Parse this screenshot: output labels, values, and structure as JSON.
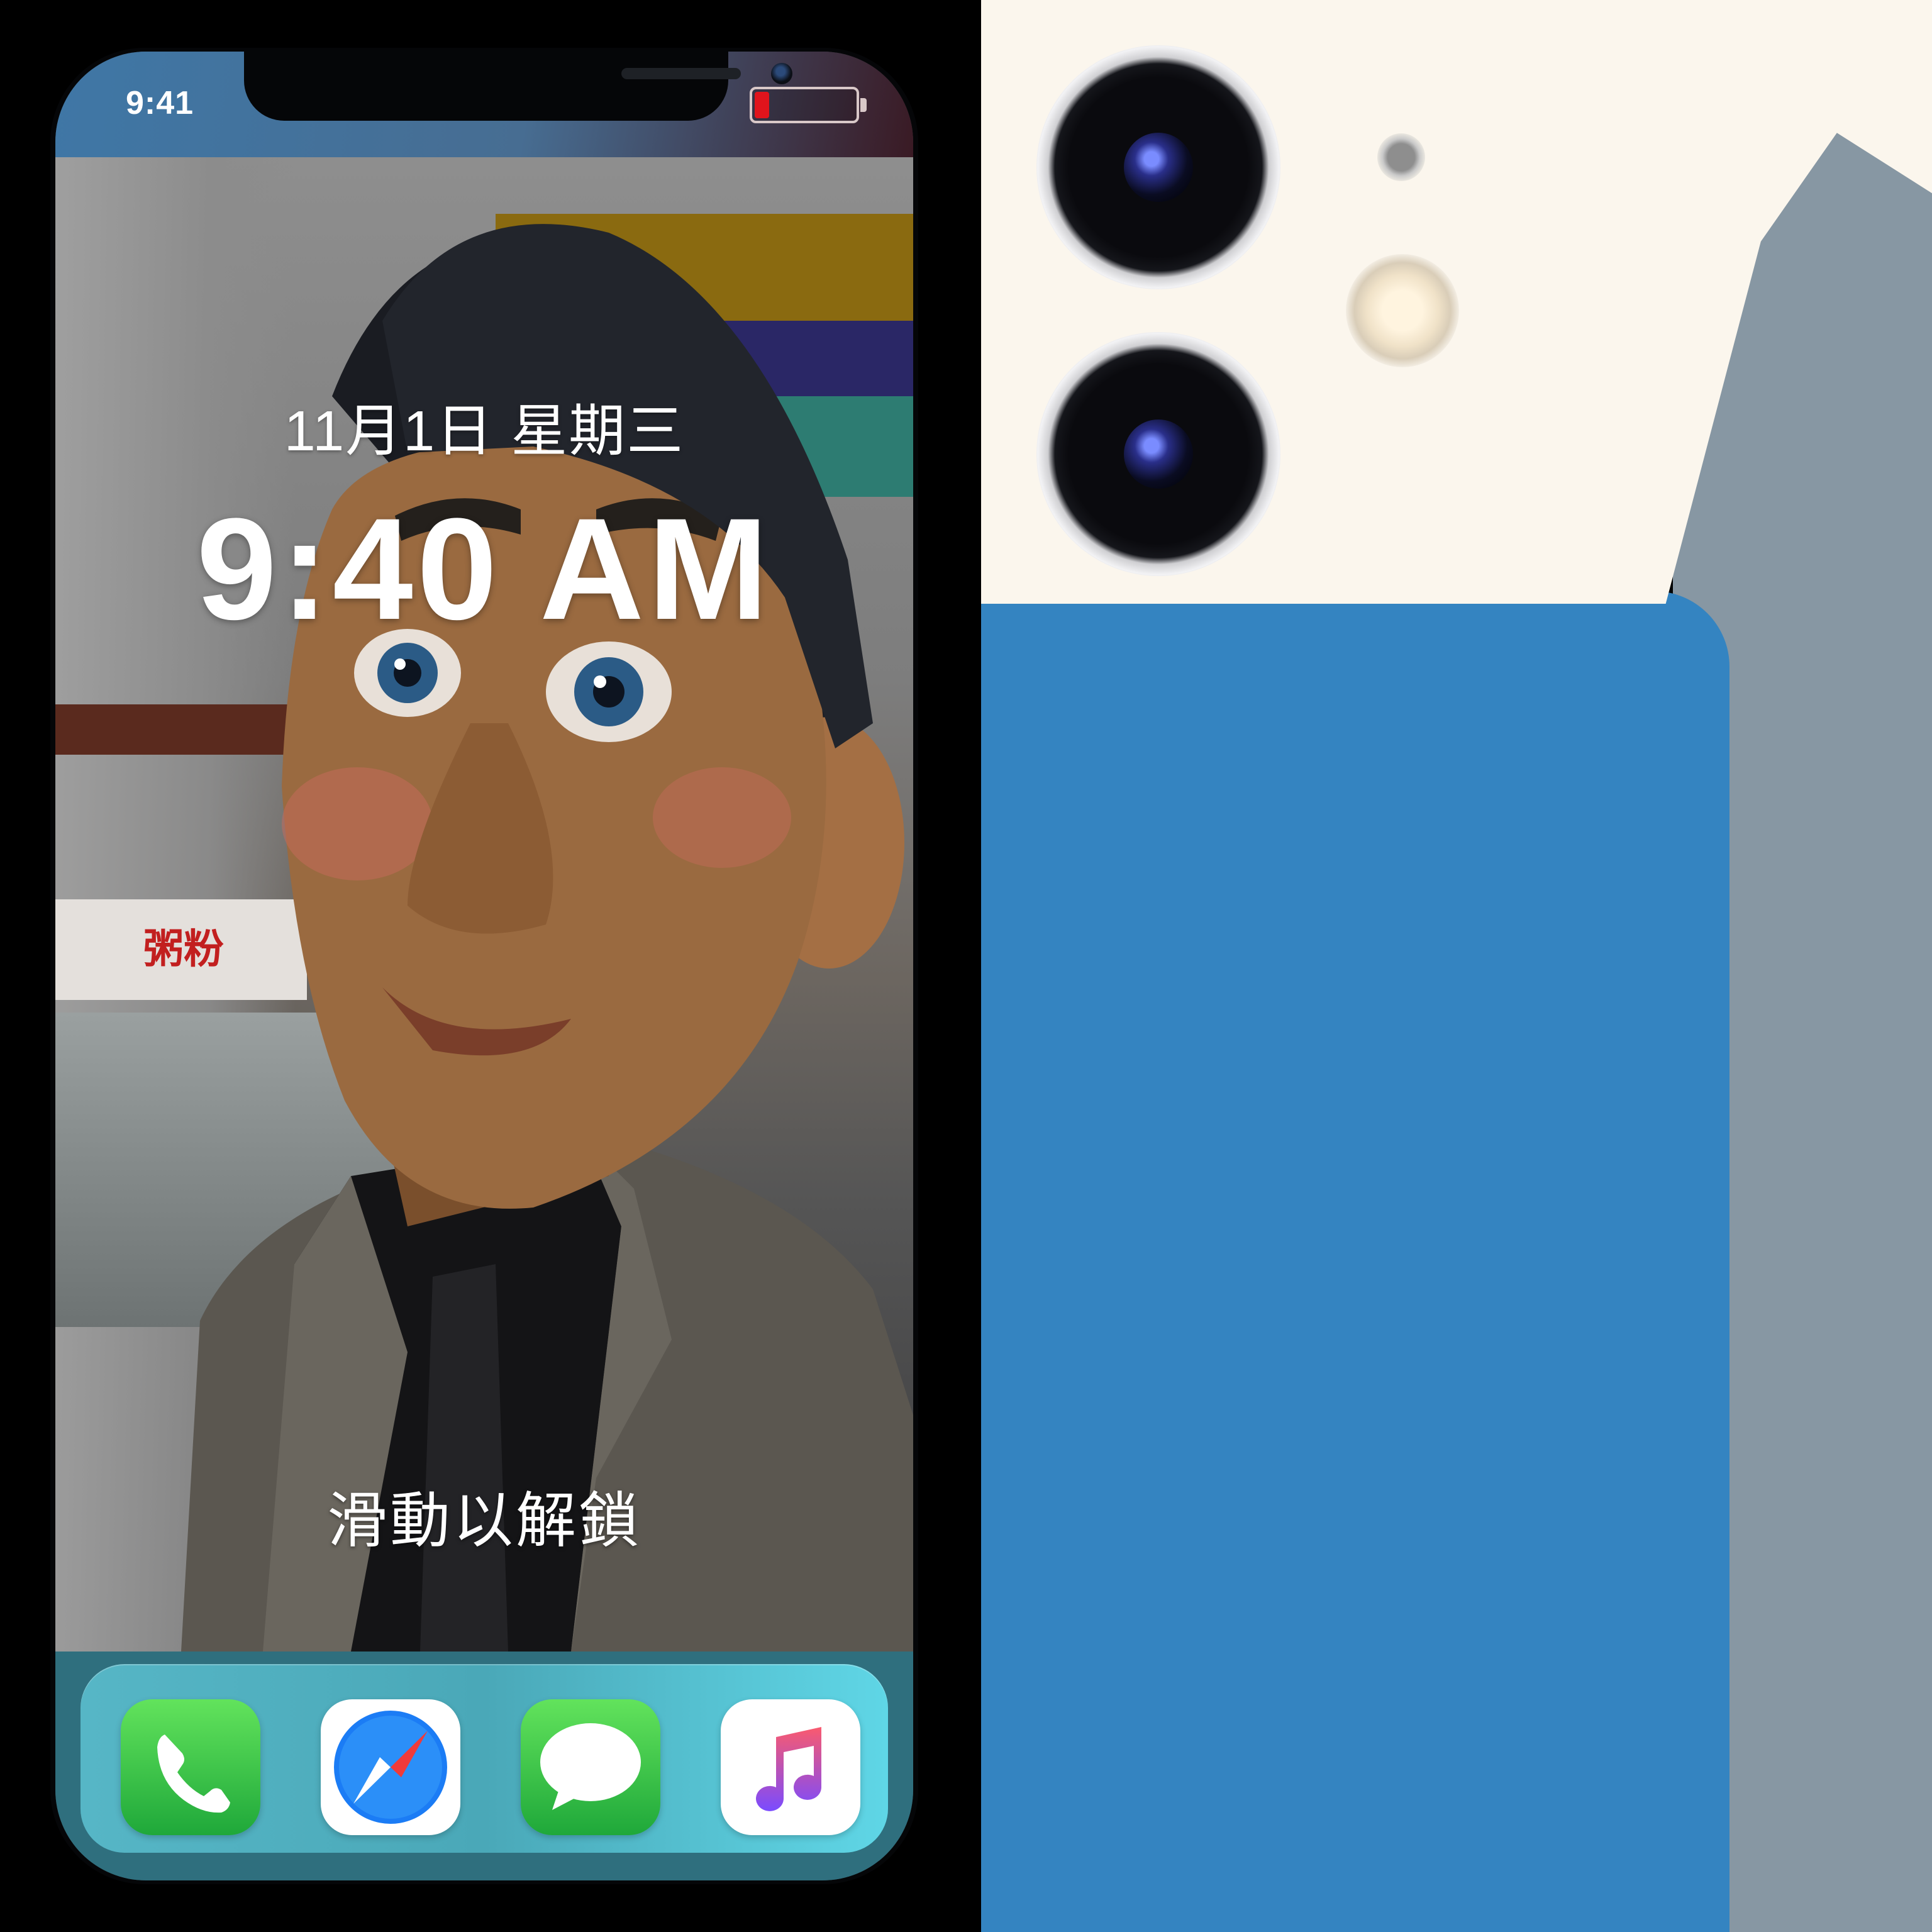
{
  "status_bar": {
    "time": "9:41",
    "battery_level_fraction": 0.14,
    "battery_color": "#e0141c"
  },
  "lock_screen": {
    "date": "11月1日 星期三",
    "time": "9:40 AM",
    "unlock_hint": "滑動以解鎖",
    "wallpaper_sign_text": "粥粉"
  },
  "dock": {
    "apps": [
      {
        "name": "Phone",
        "icon": "phone-app-icon"
      },
      {
        "name": "Safari",
        "icon": "safari-app-icon"
      },
      {
        "name": "Messages",
        "icon": "messages-app-icon"
      },
      {
        "name": "Music",
        "icon": "music-app-icon"
      }
    ]
  },
  "colors": {
    "phone_green": "#1fa83a",
    "back_blue": "#3484c1",
    "back_white": "#fbf6ed"
  }
}
